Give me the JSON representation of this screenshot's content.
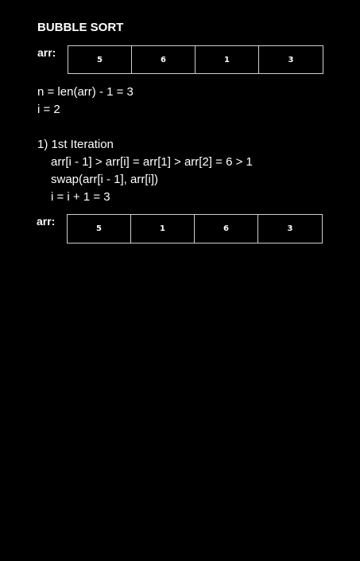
{
  "title": "BUBBLE SORT",
  "initial_array": {
    "label": "arr:",
    "cells": [
      "5",
      "6",
      "1",
      "3"
    ]
  },
  "setup": {
    "line1": "n = len(arr) - 1 = 3",
    "line2": "i = 2"
  },
  "iteration": {
    "heading": "1) 1st Iteration",
    "compare": "arr[i - 1] > arr[i] = arr[1] > arr[2] = 6 > 1",
    "swap": "swap(arr[i - 1], arr[i])",
    "increment": "i = i + 1 = 3"
  },
  "result_array": {
    "label": "arr:",
    "cells": [
      "5",
      "1",
      "6",
      "3"
    ]
  }
}
